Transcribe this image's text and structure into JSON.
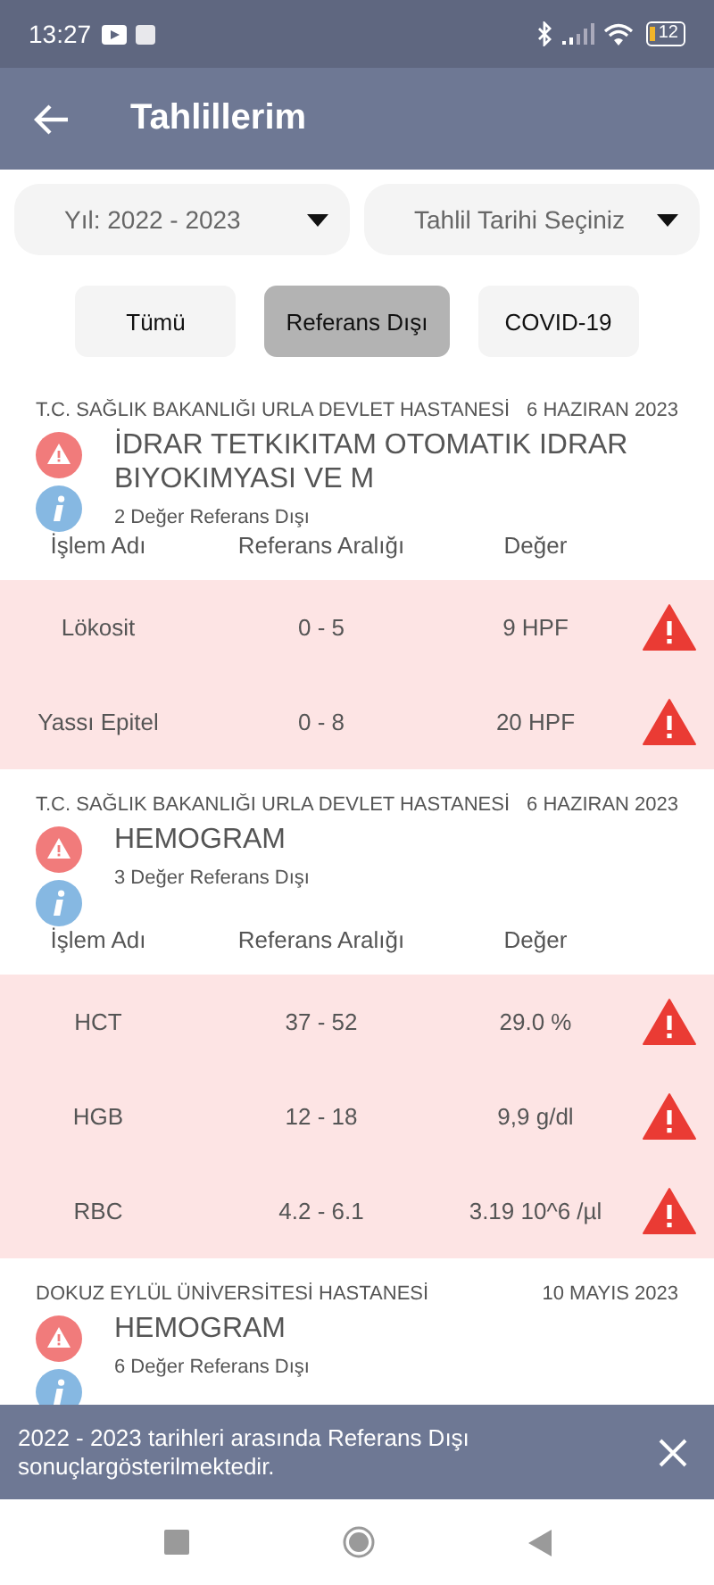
{
  "status_bar": {
    "time": "13:27",
    "battery": "12"
  },
  "app_bar": {
    "title": "Tahlillerim"
  },
  "filters": [
    {
      "value": "Yıl: 2022 - 2023"
    },
    {
      "value": "Tahlil Tarihi Seçiniz"
    }
  ],
  "chips": [
    {
      "label": "Tümü",
      "selected": false
    },
    {
      "label": "Referans Dışı",
      "selected": true
    },
    {
      "label": "COVID-19",
      "selected": false
    }
  ],
  "results": [
    {
      "hospital": "T.C. SAĞLIK BAKANLIĞI URLA DEVLET HASTANESİ",
      "date": "6 HAZIRAN 2023",
      "title": "İDRAR TETKIKITAM OTOMATIK IDRAR BIYOKIMYASI VE M",
      "summary": "2 Değer Referans Dışı",
      "columns": [
        "İşlem Adı",
        "Referans Aralığı",
        "Değer"
      ],
      "rows": [
        {
          "name": "Lökosit",
          "range": "0 - 5",
          "value": "9 HPF",
          "out_of_range": true
        },
        {
          "name": "Yassı Epitel",
          "range": "0 - 8",
          "value": "20 HPF",
          "out_of_range": true
        }
      ]
    },
    {
      "hospital": "T.C. SAĞLIK BAKANLIĞI URLA DEVLET HASTANESİ",
      "date": "6 HAZIRAN 2023",
      "title": "HEMOGRAM",
      "summary": "3 Değer Referans Dışı",
      "columns": [
        "İşlem Adı",
        "Referans Aralığı",
        "Değer"
      ],
      "rows": [
        {
          "name": "HCT",
          "range": "37 - 52",
          "value": "29.0 %",
          "out_of_range": true
        },
        {
          "name": "HGB",
          "range": "12 - 18",
          "value": "9,9 g/dl",
          "out_of_range": true
        },
        {
          "name": "RBC",
          "range": "4.2 - 6.1",
          "value": "3.19 10^6 /µl",
          "out_of_range": true
        }
      ]
    },
    {
      "hospital": "DOKUZ EYLÜL ÜNİVERSİTESİ HASTANESİ",
      "date": "10 MAYIS 2023",
      "title": "HEMOGRAM",
      "summary": "6 Değer Referans Dışı"
    }
  ],
  "snackbar": {
    "message": "2022 - 2023 tarihleri arasında Referans Dışı sonuçlargösterilmektedir."
  }
}
